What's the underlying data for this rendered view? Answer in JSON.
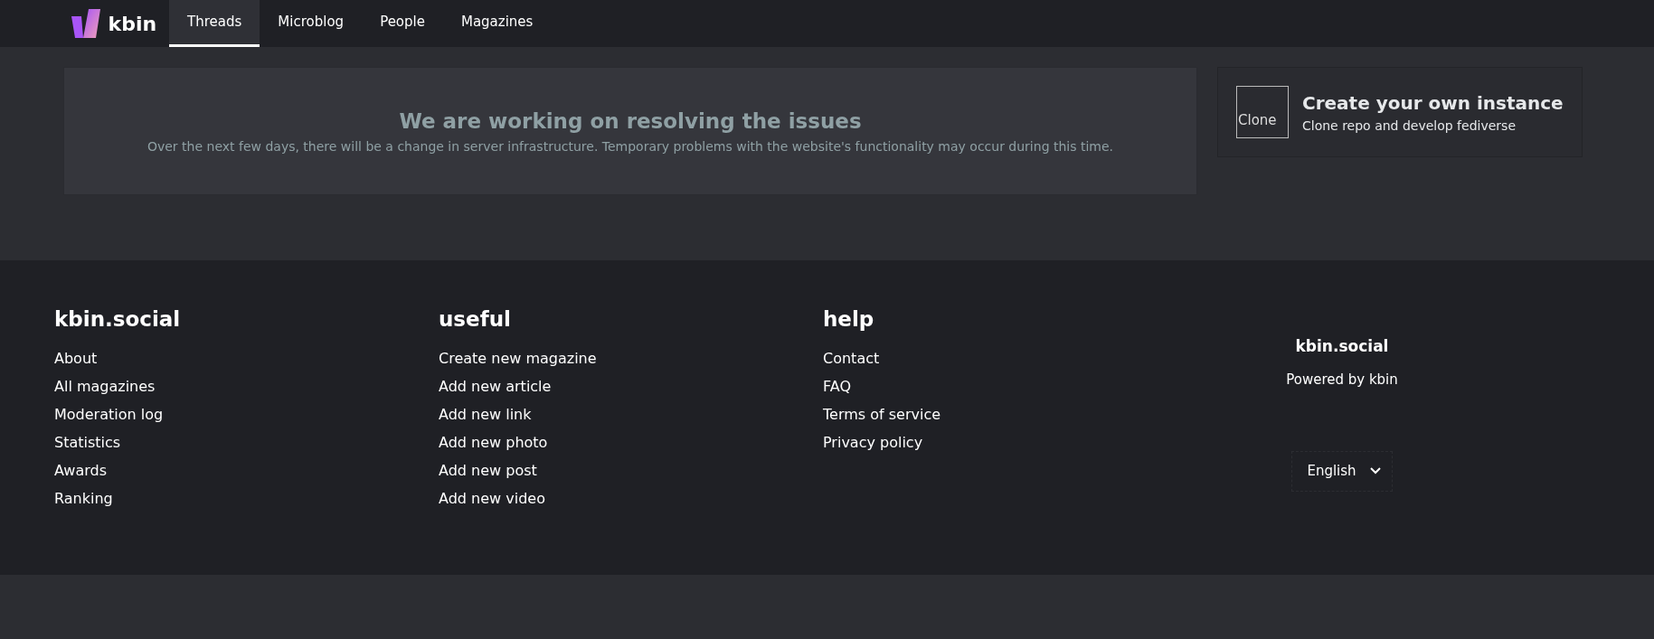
{
  "brand": {
    "name": "kbin"
  },
  "tabs": [
    {
      "label": "Threads",
      "selected": true
    },
    {
      "label": "Microblog",
      "selected": false
    },
    {
      "label": "People",
      "selected": false
    },
    {
      "label": "Magazines",
      "selected": false
    }
  ],
  "alert": {
    "title": "We are working on resolving the issues",
    "text": "Over the next few days, there will be a change in server infrastructure. Temporary problems with the website's functionality may occur during this time."
  },
  "promo": {
    "image_alt": "Clone",
    "title": "Create your own instance",
    "subtitle": "Clone repo and develop fediverse"
  },
  "footer": {
    "columns": [
      {
        "title": "kbin.social",
        "links": [
          "About",
          "All magazines",
          "Moderation log",
          "Statistics",
          "Awards",
          "Ranking"
        ]
      },
      {
        "title": "useful",
        "links": [
          "Create new magazine",
          "Add new article",
          "Add new link",
          "Add new photo",
          "Add new post",
          "Add new video"
        ]
      },
      {
        "title": "help",
        "links": [
          "Contact",
          "FAQ",
          "Terms of service",
          "Privacy policy"
        ]
      }
    ],
    "site_name": "kbin.social",
    "powered_by": "Powered by kbin",
    "language": "English"
  }
}
